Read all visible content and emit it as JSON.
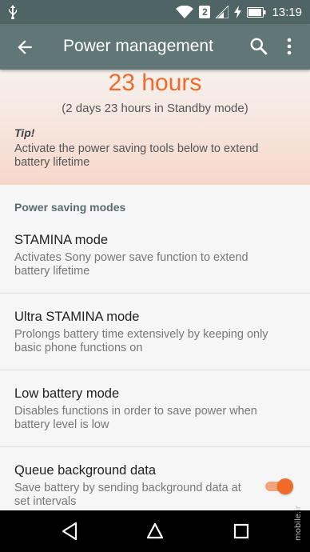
{
  "status_bar": {
    "time": "13:19",
    "sim_slot": "2",
    "icons": [
      "usb-icon",
      "wifi-icon",
      "signal-icon",
      "charging-icon",
      "battery-icon"
    ]
  },
  "app_bar": {
    "title": "Power management",
    "icons": [
      "back-arrow-icon",
      "search-icon",
      "more-vert-icon"
    ]
  },
  "battery": {
    "estimate": "23 hours",
    "standby": "(2 days 23 hours in Standby mode)",
    "accent_color": "#f06a28"
  },
  "tip": {
    "title": "Tip!",
    "text": "Activate the power saving tools below to extend battery lifetime"
  },
  "section": {
    "header": "Power saving modes"
  },
  "items": [
    {
      "title": "STAMINA mode",
      "subtitle": "Activates Sony power save function to extend battery lifetime"
    },
    {
      "title": "Ultra STAMINA mode",
      "subtitle": "Prolongs battery time extensively by keeping only basic phone functions on"
    },
    {
      "title": "Low battery mode",
      "subtitle": "Disables functions in order to save power when battery level is low"
    },
    {
      "title": "Queue background data",
      "subtitle": "Save battery by sending background data at set intervals",
      "toggle_on": true
    }
  ],
  "nav_bar": {
    "icons": [
      "nav-back-icon",
      "nav-home-icon",
      "nav-recents-icon"
    ]
  },
  "watermark": "mobile.ir"
}
